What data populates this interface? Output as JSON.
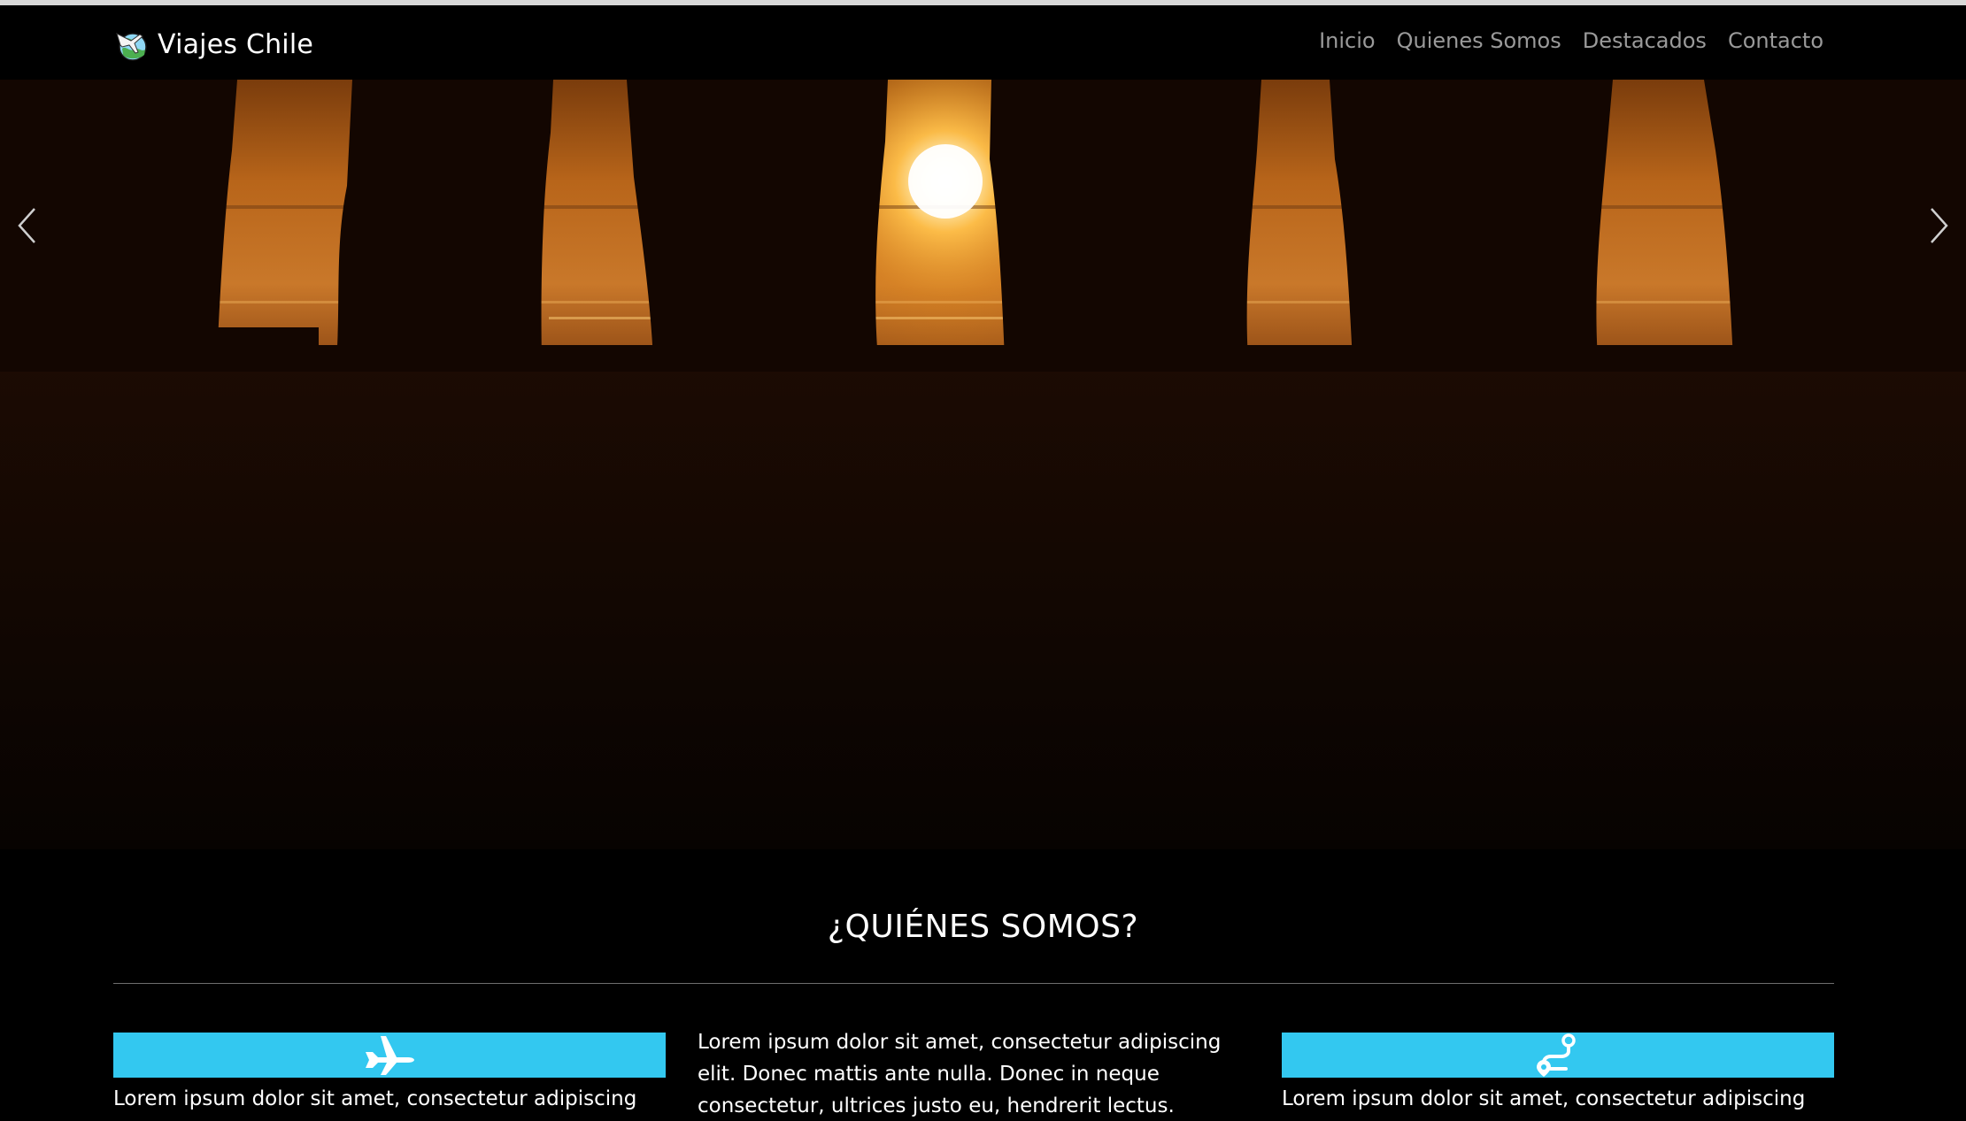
{
  "brand": {
    "name": "Viajes Chile",
    "logo_icon": "globe-plane-logo-icon"
  },
  "nav": {
    "items": [
      {
        "label": "Inicio"
      },
      {
        "label": "Quienes Somos"
      },
      {
        "label": "Destacados"
      },
      {
        "label": "Contacto"
      }
    ]
  },
  "hero": {
    "image_subject": "moai-sunset",
    "prev_icon": "chevron-left-icon",
    "next_icon": "chevron-right-icon"
  },
  "about": {
    "title": "¿QUIÉNES SOMOS?",
    "columns": [
      {
        "icon": "airplane-icon",
        "text": "Lorem ipsum dolor sit amet, consectetur adipiscing elit."
      },
      {
        "text": "Lorem ipsum dolor sit amet, consectetur adipiscing elit. Donec mattis ante nulla. Donec in neque consectetur, ultrices justo eu, hendrerit lectus. Nullam fermentum"
      },
      {
        "icon": "route-icon",
        "text": "Lorem ipsum dolor sit amet, consectetur adipiscing elit."
      }
    ]
  },
  "colors": {
    "accent": "#33c8f0",
    "nav_link": "#9a9a9a",
    "background": "#000000"
  }
}
